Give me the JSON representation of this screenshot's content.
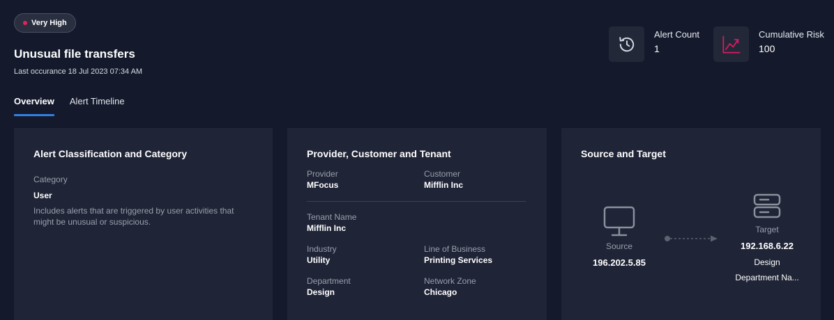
{
  "header": {
    "severity": "Very High",
    "title": "Unusual file transfers",
    "last_occurrence_label": "Last occurance",
    "last_occurrence_value": "18 Jul 2023 07:34 AM"
  },
  "metrics": {
    "alert_count_label": "Alert Count",
    "alert_count_value": "1",
    "cumulative_risk_label": "Cumulative Risk",
    "cumulative_risk_value": "100"
  },
  "tabs": [
    {
      "label": "Overview",
      "active": true
    },
    {
      "label": "Alert Timeline",
      "active": false
    }
  ],
  "classification": {
    "title": "Alert Classification and Category",
    "category_label": "Category",
    "category_value": "User",
    "description": "Includes alerts that are triggered by user activities that might be unusual or suspicious."
  },
  "provider": {
    "title": "Provider, Customer and Tenant",
    "provider_label": "Provider",
    "provider_value": "MFocus",
    "customer_label": "Customer",
    "customer_value": "Mifflin Inc",
    "tenant_label": "Tenant Name",
    "tenant_value": "Mifflin Inc",
    "industry_label": "Industry",
    "industry_value": "Utility",
    "lob_label": "Line of Business",
    "lob_value": "Printing Services",
    "department_label": "Department",
    "department_value": "Design",
    "zone_label": "Network Zone",
    "zone_value": "Chicago"
  },
  "source_target": {
    "title": "Source and Target",
    "source_label": "Source",
    "source_ip": "196.202.5.85",
    "target_label": "Target",
    "target_ip": "192.168.6.22",
    "target_sub1": "Design",
    "target_sub2": "Department Na..."
  },
  "colors": {
    "background": "#141a2c",
    "card": "#1f2436",
    "accent": "#2f7fe6",
    "severity_dot": "#e0245e",
    "risk_icon": "#d81b60"
  }
}
